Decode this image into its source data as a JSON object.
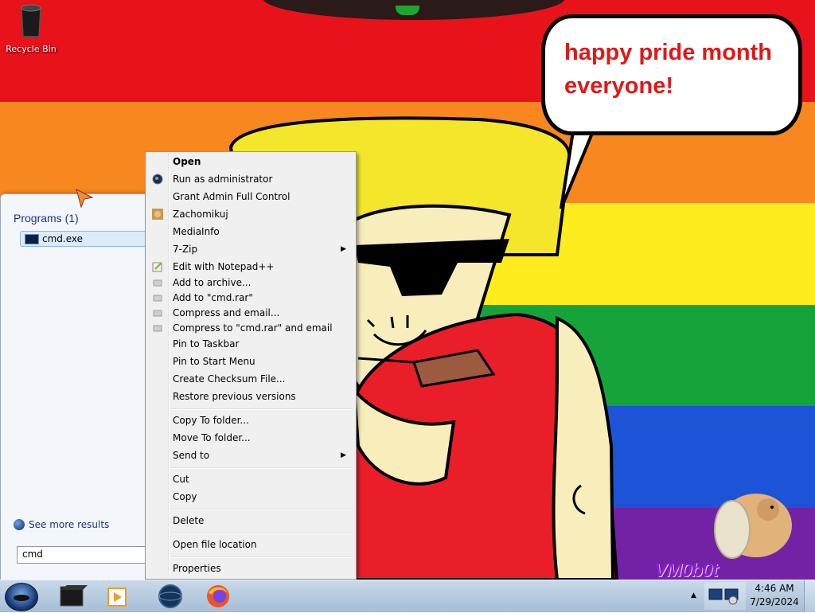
{
  "desktop": {
    "recycle_bin_label": "Recycle Bin",
    "bubble_text": "happy pride month everyone!",
    "watermark": "VM0b0t",
    "colors": {
      "red": "#e8121a",
      "orange": "#f7871e",
      "yellow": "#ffec1e",
      "green": "#16a33a",
      "blue": "#1d53d6",
      "purple": "#7322a6"
    }
  },
  "start_menu": {
    "programs_header": "Programs (1)",
    "program_item": "cmd.exe",
    "see_more": "See more results",
    "search_value": "cmd"
  },
  "context_menu": {
    "items": [
      {
        "label": "Open",
        "bold": true
      },
      {
        "label": "Run as administrator",
        "icon": "shield-icon"
      },
      {
        "label": "Grant Admin Full Control"
      },
      {
        "label": "Zachomikuj",
        "icon": "hamster-icon"
      },
      {
        "label": "MediaInfo"
      },
      {
        "label": "7-Zip",
        "submenu": true
      },
      {
        "label": "Edit with Notepad++",
        "icon": "notepad-icon"
      },
      {
        "label": "Add to archive...",
        "icon": "archive-icon"
      },
      {
        "label": "Add to \"cmd.rar\"",
        "icon": "archive-icon"
      },
      {
        "label": "Compress and email...",
        "icon": "archive-icon"
      },
      {
        "label": "Compress to \"cmd.rar\" and email",
        "icon": "archive-icon"
      },
      {
        "label": "Pin to Taskbar"
      },
      {
        "label": "Pin to Start Menu"
      },
      {
        "label": "Create Checksum File..."
      },
      {
        "label": "Restore previous versions"
      },
      {
        "label": "Copy To folder..."
      },
      {
        "label": "Move To folder..."
      },
      {
        "label": "Send to",
        "submenu": true
      },
      {
        "label": "Cut"
      },
      {
        "label": "Copy"
      },
      {
        "label": "Delete"
      },
      {
        "label": "Open file location"
      },
      {
        "label": "Properties"
      }
    ]
  },
  "taskbar": {
    "time": "4:46 AM",
    "date": "7/29/2024",
    "buttons": [
      "cmd-window-icon",
      "media-player-icon",
      "globe-browser-icon",
      "firefox-icon"
    ]
  }
}
